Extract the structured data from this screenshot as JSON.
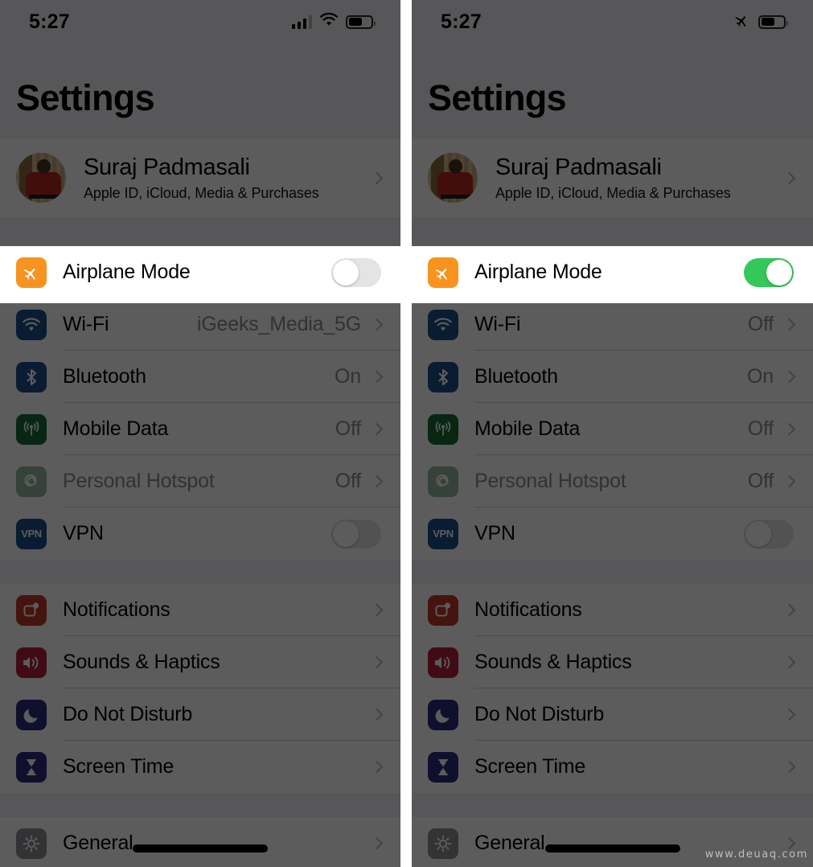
{
  "watermark": "www.deuaq.com",
  "colors": {
    "toggle_on": "#34c759",
    "toggle_off_track": "#e4e4e6",
    "airplane_tile": "#f7931e",
    "wifi_tile": "#1d4e89",
    "bluetooth_tile": "#1d4e89",
    "mobile_data_tile": "#1b6b36",
    "hotspot_tile": "#1b6b36",
    "vpn_tile": "#1d4e89",
    "notifications_tile": "#c0392b",
    "sounds_tile": "#b3203a",
    "dnd_tile": "#2b2b80",
    "screen_time_tile": "#2b2b80",
    "general_tile": "#8e8e93",
    "dim_overlay": "rgba(0,0,0,0.64)"
  },
  "panels": [
    {
      "id": "left",
      "statusbar": {
        "time": "5:27",
        "icons": [
          "cellular-bars-icon",
          "wifi-icon",
          "battery-icon"
        ],
        "battery_percent": 62
      },
      "title": "Settings",
      "account": {
        "name": "Suraj Padmasali",
        "subtitle": "Apple ID, iCloud, Media & Purchases",
        "avatar": "user-photo-avatar"
      },
      "airplane": {
        "label": "Airplane Mode",
        "icon": "airplane-icon",
        "toggle_on": false
      },
      "connectivity_rows": [
        {
          "label": "Wi-Fi",
          "value": "iGeeks_Media_5G",
          "icon": "wifi-icon",
          "type": "chevron",
          "disabled": false
        },
        {
          "label": "Bluetooth",
          "value": "On",
          "icon": "bluetooth-icon",
          "type": "chevron",
          "disabled": false
        },
        {
          "label": "Mobile Data",
          "value": "Off",
          "icon": "mobile-data-icon",
          "type": "chevron",
          "disabled": false
        },
        {
          "label": "Personal Hotspot",
          "value": "Off",
          "icon": "hotspot-icon",
          "type": "chevron",
          "disabled": true
        },
        {
          "label": "VPN",
          "value": "",
          "icon": "vpn-icon",
          "type": "toggle",
          "toggle_on": false,
          "disabled": false
        }
      ],
      "system_rows": [
        {
          "label": "Notifications",
          "value": "",
          "icon": "notifications-icon",
          "type": "chevron"
        },
        {
          "label": "Sounds & Haptics",
          "value": "",
          "icon": "sounds-icon",
          "type": "chevron"
        },
        {
          "label": "Do Not Disturb",
          "value": "",
          "icon": "moon-icon",
          "type": "chevron"
        },
        {
          "label": "Screen Time",
          "value": "",
          "icon": "hourglass-icon",
          "type": "chevron"
        }
      ],
      "bottom_rows": [
        {
          "label": "General",
          "value": "",
          "icon": "gear-icon",
          "type": "chevron"
        }
      ]
    },
    {
      "id": "right",
      "statusbar": {
        "time": "5:27",
        "icons": [
          "airplane-icon",
          "battery-icon"
        ],
        "battery_percent": 62
      },
      "title": "Settings",
      "account": {
        "name": "Suraj Padmasali",
        "subtitle": "Apple ID, iCloud, Media & Purchases",
        "avatar": "user-photo-avatar"
      },
      "airplane": {
        "label": "Airplane Mode",
        "icon": "airplane-icon",
        "toggle_on": true
      },
      "connectivity_rows": [
        {
          "label": "Wi-Fi",
          "value": "Off",
          "icon": "wifi-icon",
          "type": "chevron",
          "disabled": false
        },
        {
          "label": "Bluetooth",
          "value": "On",
          "icon": "bluetooth-icon",
          "type": "chevron",
          "disabled": false
        },
        {
          "label": "Mobile Data",
          "value": "Off",
          "icon": "mobile-data-icon",
          "type": "chevron",
          "disabled": false
        },
        {
          "label": "Personal Hotspot",
          "value": "Off",
          "icon": "hotspot-icon",
          "type": "chevron",
          "disabled": true
        },
        {
          "label": "VPN",
          "value": "",
          "icon": "vpn-icon",
          "type": "toggle",
          "toggle_on": false,
          "disabled": false
        }
      ],
      "system_rows": [
        {
          "label": "Notifications",
          "value": "",
          "icon": "notifications-icon",
          "type": "chevron"
        },
        {
          "label": "Sounds & Haptics",
          "value": "",
          "icon": "sounds-icon",
          "type": "chevron"
        },
        {
          "label": "Do Not Disturb",
          "value": "",
          "icon": "moon-icon",
          "type": "chevron"
        },
        {
          "label": "Screen Time",
          "value": "",
          "icon": "hourglass-icon",
          "type": "chevron"
        }
      ],
      "bottom_rows": [
        {
          "label": "General",
          "value": "",
          "icon": "gear-icon",
          "type": "chevron"
        }
      ]
    }
  ]
}
